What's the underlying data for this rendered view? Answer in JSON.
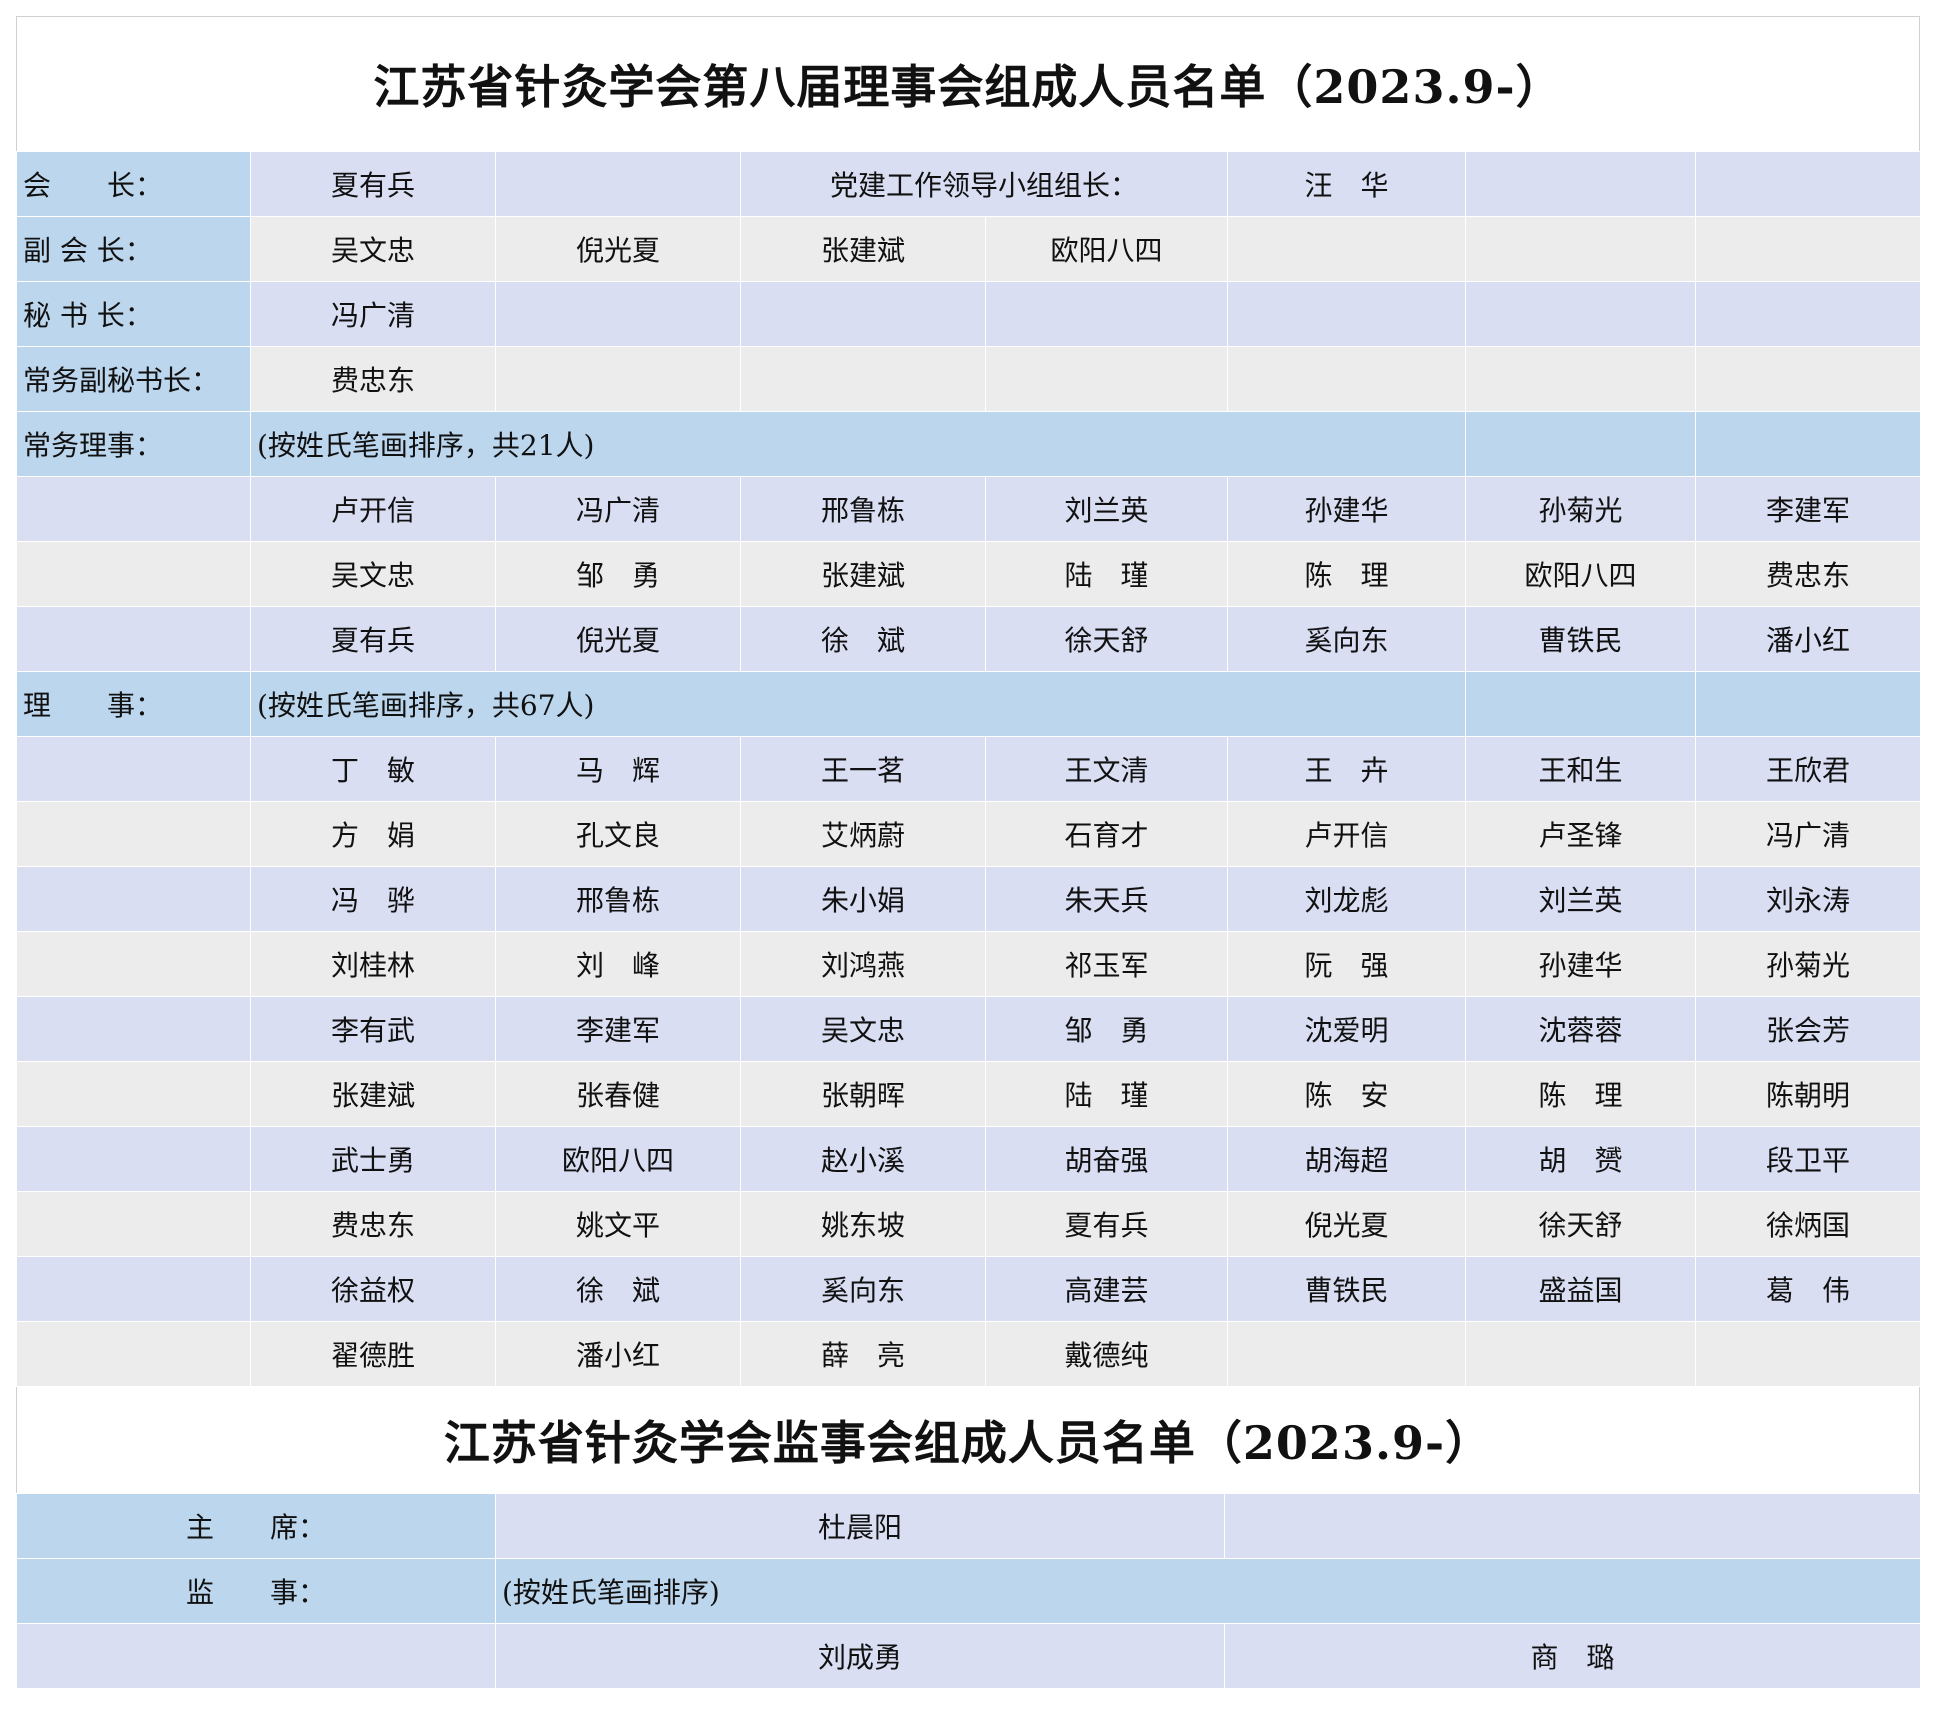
{
  "board": {
    "title": "江苏省针灸学会第八届理事会组成人员名单（2023.9-）",
    "president_label": "会　　长：",
    "president": "夏有兵",
    "party_label": "党建工作领导小组组长：",
    "party_leader": "汪　华",
    "vice_label": "副 会 长：",
    "vice_presidents": [
      "吴文忠",
      "倪光夏",
      "张建斌",
      "欧阳八四"
    ],
    "secretary_label": "秘 书 长：",
    "secretary": "冯广清",
    "exec_deputy_label": "常务副秘书长：",
    "exec_deputy": "费忠东",
    "standing_label": "常务理事：",
    "standing_note": "(按姓氏笔画排序，共21人)",
    "standing_rows": [
      [
        "卢开信",
        "冯广清",
        "邢鲁栋",
        "刘兰英",
        "孙建华",
        "孙菊光",
        "李建军"
      ],
      [
        "吴文忠",
        "邹　勇",
        "张建斌",
        "陆　瑾",
        "陈　理",
        "欧阳八四",
        "费忠东"
      ],
      [
        "夏有兵",
        "倪光夏",
        "徐　斌",
        "徐天舒",
        "奚向东",
        "曹铁民",
        "潘小红"
      ]
    ],
    "director_label": "理　　事：",
    "director_note": "(按姓氏笔画排序，共67人)",
    "director_rows": [
      [
        "丁　敏",
        "马　辉",
        "王一茗",
        "王文清",
        "王　卉",
        "王和生",
        "王欣君"
      ],
      [
        "方　娟",
        "孔文良",
        "艾炳蔚",
        "石育才",
        "卢开信",
        "卢圣锋",
        "冯广清"
      ],
      [
        "冯　骅",
        "邢鲁栋",
        "朱小娟",
        "朱天兵",
        "刘龙彪",
        "刘兰英",
        "刘永涛"
      ],
      [
        "刘桂林",
        "刘　峰",
        "刘鸿燕",
        "祁玉军",
        "阮　强",
        "孙建华",
        "孙菊光"
      ],
      [
        "李有武",
        "李建军",
        "吴文忠",
        "邹　勇",
        "沈爱明",
        "沈蓉蓉",
        "张会芳"
      ],
      [
        "张建斌",
        "张春健",
        "张朝晖",
        "陆　瑾",
        "陈　安",
        "陈　理",
        "陈朝明"
      ],
      [
        "武士勇",
        "欧阳八四",
        "赵小溪",
        "胡奋强",
        "胡海超",
        "胡　赟",
        "段卫平"
      ],
      [
        "费忠东",
        "姚文平",
        "姚东坡",
        "夏有兵",
        "倪光夏",
        "徐天舒",
        "徐炳国"
      ],
      [
        "徐益权",
        "徐　斌",
        "奚向东",
        "高建芸",
        "曹铁民",
        "盛益国",
        "葛　伟"
      ],
      [
        "翟德胜",
        "潘小红",
        "薛　亮",
        "戴德纯",
        "",
        "",
        ""
      ]
    ]
  },
  "supervisors": {
    "title": "江苏省针灸学会监事会组成人员名单（2023.9-）",
    "chair_label": "主　　席：",
    "chair": "杜晨阳",
    "member_label": "监　　事：",
    "member_note": "(按姓氏笔画排序)",
    "members": [
      "刘成勇",
      "商　璐"
    ]
  }
}
